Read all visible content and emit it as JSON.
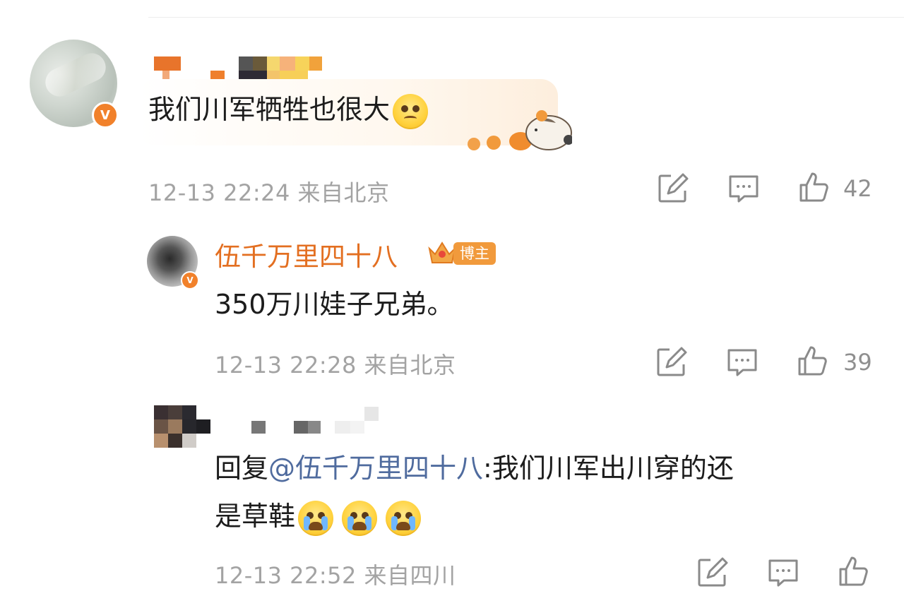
{
  "comments": [
    {
      "text": "我们川军牺牲也很大",
      "emoji": "pleading-face",
      "time": "12-13 22:24",
      "location": "来自北京",
      "likes": "42"
    },
    {
      "author": "伍千万里四十八",
      "author_badge": "博主",
      "text": "350万川娃子兄弟。",
      "time": "12-13 22:28",
      "location": "来自北京",
      "likes": "39"
    },
    {
      "reply_prefix": "回复",
      "mention": "@伍千万里四十八",
      "text_line1": ":我们川军出川穿的还",
      "text_line2": "是草鞋",
      "emojis": [
        "crying-face",
        "crying-face",
        "crying-face"
      ],
      "time": "12-13 22:52",
      "location": "来自四川"
    }
  ],
  "icons": {
    "verified": "V",
    "repost": "repost-icon",
    "comment": "comment-icon",
    "like": "thumbs-up-icon"
  },
  "colors": {
    "author": "#e36f21",
    "mention": "#4f6b9e",
    "verified": "#f1812b",
    "meta": "#a3a3a3"
  }
}
